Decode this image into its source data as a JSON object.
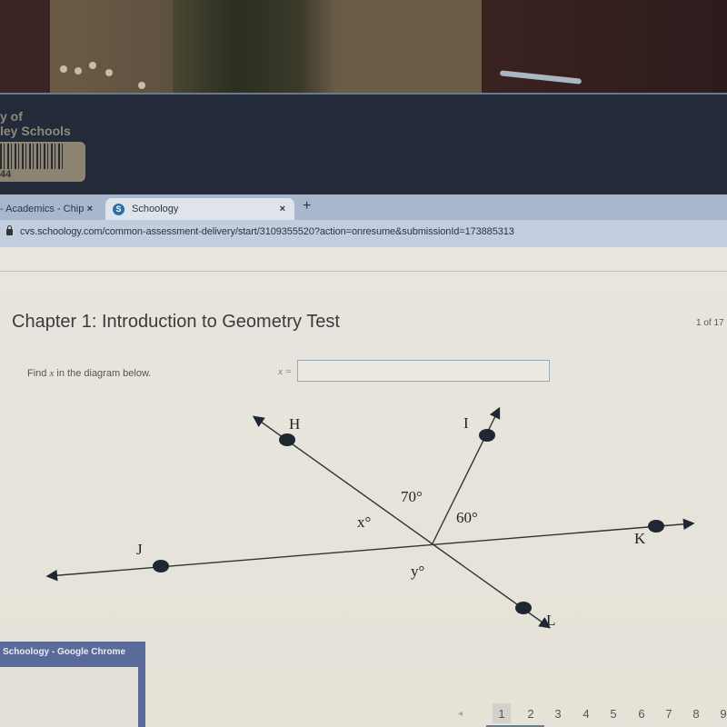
{
  "sticker": {
    "line1": "y of",
    "line2": "ley Schools",
    "number": "44"
  },
  "browser": {
    "tabs": [
      {
        "label": "- Academics - Chip",
        "active": false
      },
      {
        "label": "Schoology",
        "active": true,
        "favicon": "S"
      }
    ],
    "new_tab_label": "+",
    "close_label": "×",
    "url": "cvs.schoology.com/common-assessment-delivery/start/3109355520?action=onresume&submissionId=173885313"
  },
  "page": {
    "title": "Chapter 1: Introduction to Geometry Test",
    "question_count": "1 of 17",
    "prompt_prefix": "Find ",
    "prompt_var": "x",
    "prompt_suffix": " in the diagram below.",
    "answer_label": "x =",
    "answer_value": "",
    "answer_placeholder": ""
  },
  "diagram": {
    "points": [
      "H",
      "I",
      "J",
      "K",
      "L"
    ],
    "angle_labels": {
      "x": "x°",
      "a70": "70°",
      "a60": "60°",
      "y": "y°"
    }
  },
  "pagination": {
    "current": 1,
    "pages": [
      "1",
      "2",
      "3",
      "4",
      "5",
      "6",
      "7",
      "8",
      "9"
    ],
    "prev_label": "◂"
  },
  "taskbar_preview": {
    "title": "Schoology - Google Chrome"
  }
}
